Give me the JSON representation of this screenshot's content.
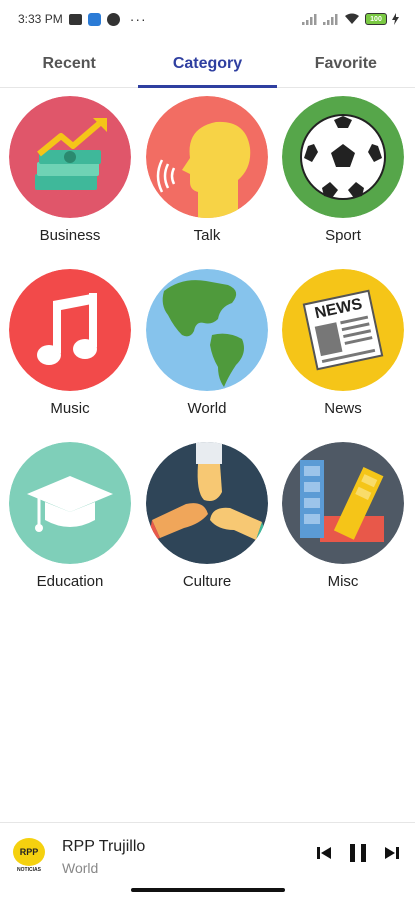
{
  "status_bar": {
    "time": "3:33 PM",
    "battery": "100",
    "icons": [
      "message-icon",
      "app-icon",
      "mic-icon",
      "more-icon",
      "signal-icon",
      "wifi-icon",
      "battery-icon",
      "charging-icon"
    ]
  },
  "tabs": [
    {
      "label": "Recent",
      "active": false
    },
    {
      "label": "Category",
      "active": true
    },
    {
      "label": "Favorite",
      "active": false
    }
  ],
  "categories": [
    {
      "label": "Business",
      "icon": "money-chart-icon",
      "color": "#e0566a"
    },
    {
      "label": "Talk",
      "icon": "talking-head-icon",
      "color": "#f26d63"
    },
    {
      "label": "Sport",
      "icon": "soccer-ball-icon",
      "color": "#56a64a"
    },
    {
      "label": "Music",
      "icon": "music-note-icon",
      "color": "#f24a4a"
    },
    {
      "label": "World",
      "icon": "globe-icon",
      "color": "#86c3ec"
    },
    {
      "label": "News",
      "icon": "newspaper-icon",
      "color": "#f5c518"
    },
    {
      "label": "Education",
      "icon": "graduation-cap-icon",
      "color": "#7fcfb9"
    },
    {
      "label": "Culture",
      "icon": "joined-hands-icon",
      "color": "#2f4558"
    },
    {
      "label": "Misc",
      "icon": "swatches-icon",
      "color": "#4f5965"
    }
  ],
  "newspaper_text": "NEWS",
  "player": {
    "station": "RPP Trujillo",
    "category": "World",
    "logo_text": "RPP",
    "logo_subtext": "NOTICIAS"
  },
  "colors": {
    "accent": "#2f3fa0",
    "logo_yellow": "#f5d10f"
  }
}
